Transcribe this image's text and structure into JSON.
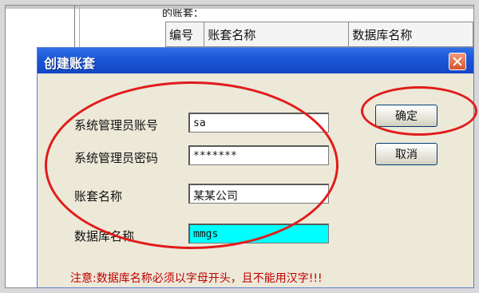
{
  "background": {
    "partial_label": "的账套：",
    "table_headers": [
      "编号",
      "账套名称",
      "数据库名称"
    ]
  },
  "dialog": {
    "title": "创建账套",
    "fields": [
      {
        "label": "系统管理员账号",
        "value": "sa"
      },
      {
        "label": "系统管理员密码",
        "value": "*******"
      },
      {
        "label": "账套名称",
        "value": "某某公司"
      },
      {
        "label": "数据库名称",
        "value": "mmgs"
      }
    ],
    "ok_label": "确定",
    "cancel_label": "取消",
    "note": "注意:数据库名称必须以字母开头，且不能用汉字!!!"
  },
  "colors": {
    "titlebar": "#1b56d6",
    "annotation": "#e21b1b",
    "note_text": "#c00000",
    "db_field": "#00ffff"
  }
}
